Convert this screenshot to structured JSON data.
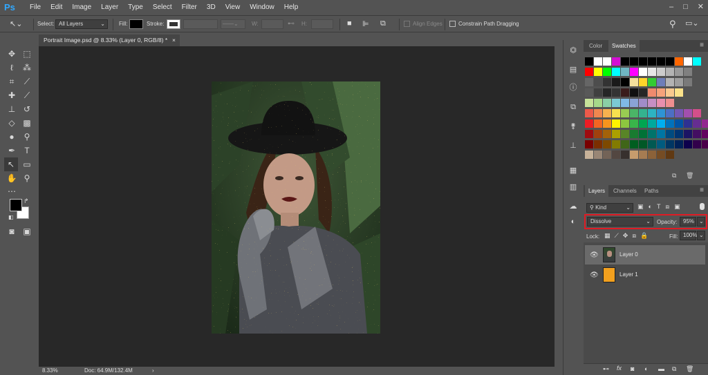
{
  "app": {
    "logo_text": "Ps"
  },
  "menu": [
    "File",
    "Edit",
    "Image",
    "Layer",
    "Type",
    "Select",
    "Filter",
    "3D",
    "View",
    "Window",
    "Help"
  ],
  "window_controls": {
    "minimize": "–",
    "maximize": "□",
    "close": "✕"
  },
  "options_bar": {
    "select_label": "Select:",
    "select_value": "All Layers",
    "fill_label": "Fill:",
    "stroke_label": "Stroke:",
    "w_label": "W:",
    "h_label": "H:",
    "align_edges": "Align Edges",
    "constrain": "Constrain Path Dragging"
  },
  "document": {
    "tab_title": "Portrait Image.psd @ 8.33% (Layer 0, RGB/8) *",
    "close": "×"
  },
  "status": {
    "zoom": "8.33%",
    "doc": "Doc: 64.9M/132.4M"
  },
  "color_panel": {
    "tabs": [
      "Color",
      "Swatches"
    ],
    "active_tab": "Swatches",
    "swatch_rows": [
      [
        "#000000",
        "#ffffff",
        "#ffffff",
        "#d40fd4",
        "#000000",
        "#000000",
        "#000000",
        "#000000",
        "#000000",
        "#000000",
        "#ff6600",
        "#ffffff",
        "#00ffff"
      ],
      [
        "#ff0000",
        "#ffff00",
        "#00ff00",
        "#00ffff",
        "#70b7c3",
        "#ff00ff",
        "#ffffff",
        "#e6e6e6",
        "#cccccc",
        "#b3b3b3",
        "#999999",
        "#808080"
      ],
      [
        "#666666",
        "#4d4d4d",
        "#333333",
        "#1a1a1a",
        "#000000",
        "#f4e09c",
        "#ffd42a",
        "#33cc33",
        "#6e7eb8",
        "#b3b3b3",
        "#9e9e9e",
        "#7a7a7a"
      ],
      [
        "#595959",
        "#404040",
        "#262626",
        "#333333",
        "#3a1c1c",
        "#101010",
        "#262626",
        "#ef8a6e",
        "#f5a27b",
        "#f9c98f",
        "#fbe28a"
      ],
      [
        "#c7e39a",
        "#a6d98a",
        "#8acfa6",
        "#7bcad3",
        "#80b9e6",
        "#8aa3d6",
        "#a18cc8",
        "#c68fc4",
        "#e88fae",
        "#ef8f8f"
      ],
      [
        "#ec5a4a",
        "#f0874f",
        "#f6b24f",
        "#f7e14f",
        "#99cc52",
        "#4bb567",
        "#34b38f",
        "#2db4c2",
        "#2e94d4",
        "#4c6fc4",
        "#7358b4",
        "#a24fae",
        "#d44f8a"
      ],
      [
        "#ed1c24",
        "#f26522",
        "#f7941d",
        "#fff200",
        "#8dc63f",
        "#39b54a",
        "#00a651",
        "#00a99d",
        "#00aeef",
        "#0072bc",
        "#0054a6",
        "#2e3192",
        "#662d91",
        "#92278f",
        "#ec008c",
        "#ed145b"
      ],
      [
        "#9e0b0f",
        "#a0410d",
        "#a36209",
        "#aba000",
        "#598527",
        "#197b30",
        "#007236",
        "#00746b",
        "#0076a3",
        "#004b80",
        "#003471",
        "#1b1464",
        "#440e62",
        "#630460",
        "#9e005d",
        "#9e0039"
      ],
      [
        "#790000",
        "#7b2e00",
        "#7d4900",
        "#827b00",
        "#406618",
        "#005e20",
        "#005826",
        "#005952",
        "#005b7f",
        "#003663",
        "#002157",
        "#0d004c",
        "#32004b",
        "#4b0049",
        "#7b0046",
        "#7a0026"
      ],
      [
        "#c7b299",
        "#998675",
        "#736357",
        "#534741",
        "#37302d",
        "#c69c6d",
        "#a67c52",
        "#8c6239",
        "#754c24",
        "#603913"
      ]
    ]
  },
  "layers_panel": {
    "tabs": [
      "Layers",
      "Channels",
      "Paths"
    ],
    "active_tab": "Layers",
    "filter_kind": "Kind",
    "blend_mode": "Dissolve",
    "opacity_label": "Opacity:",
    "opacity_value": "95%",
    "lock_label": "Lock:",
    "fill_label": "Fill:",
    "fill_value": "100%",
    "layers": [
      {
        "name": "Layer 0",
        "selected": true
      },
      {
        "name": "Layer 1",
        "selected": false
      }
    ],
    "bottom_icons": [
      "link-icon",
      "fx-icon",
      "mask-icon",
      "adjustment-icon",
      "folder-icon",
      "new-layer-icon",
      "trash-icon"
    ],
    "fx_text": "fx"
  },
  "colors": {
    "highlight_red": "#e01b24",
    "fg_color": "#000000",
    "bg_color": "#ffffff",
    "layer1_thumb": "#f2a01e"
  }
}
